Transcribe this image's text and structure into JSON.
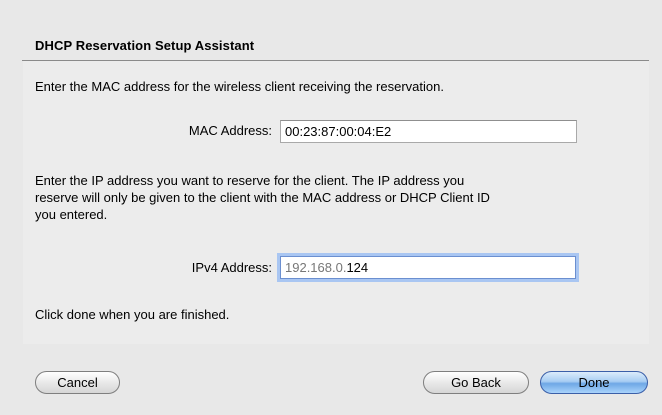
{
  "dialog": {
    "title": "DHCP Reservation Setup Assistant",
    "mac_instruction": "Enter the MAC address for the wireless client receiving the reservation.",
    "mac_label": "MAC Address:",
    "mac_value": "00:23:87:00:04:E2",
    "ip_instruction_line1": "Enter the IP address you want to reserve for the client. The IP address you",
    "ip_instruction_line2": "reserve will only be given to the client with the MAC address or DHCP Client ID",
    "ip_instruction_line3": "you entered.",
    "ip_label": "IPv4 Address:",
    "ip_prefix": "192.168.0.",
    "ip_suffix": "124",
    "finish_text": "Click done when you are finished."
  },
  "buttons": {
    "cancel": "Cancel",
    "go_back": "Go Back",
    "done": "Done"
  }
}
